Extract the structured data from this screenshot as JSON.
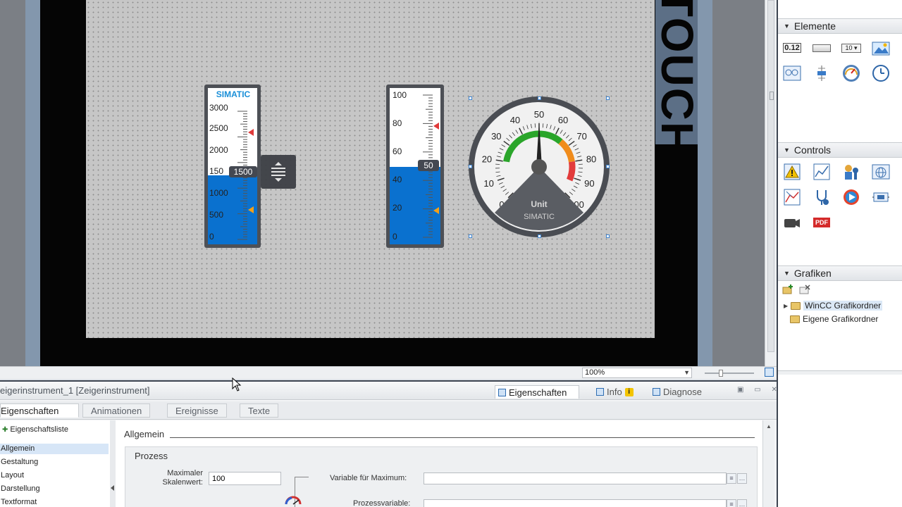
{
  "canvas": {
    "touch_label": "TOUCH",
    "bar1": {
      "title": "SIMATIC",
      "ticks": [
        "3000",
        "2500",
        "2000",
        "150",
        "1000",
        "500",
        "0"
      ],
      "readout": "1500",
      "value_fraction": 0.5,
      "upper_limit_color": "#e03a3a",
      "lower_limit_color": "#f2a01a",
      "fill_color": "#0a71cf"
    },
    "bar2": {
      "ticks": [
        "100",
        "80",
        "60",
        "40",
        "20",
        "0"
      ],
      "readout": "50",
      "value_fraction": 0.5
    },
    "gauge": {
      "ticks": [
        "0",
        "10",
        "20",
        "30",
        "40",
        "50",
        "60",
        "70",
        "80",
        "90",
        "100"
      ],
      "unit": "Unit",
      "brand": "SIMATIC",
      "value": 50,
      "zones": {
        "green": "#2aa52a",
        "orange": "#f08c1c",
        "red": "#e23b3b"
      }
    }
  },
  "zoom": {
    "value": "100%"
  },
  "properties": {
    "title": "eigerinstrument_1 [Zeigerinstrument]",
    "tabs": {
      "eigenschaften": "Eigenschaften",
      "info": "Info",
      "diagnose": "Diagnose"
    },
    "subtabs": [
      "Eigenschaften",
      "Animationen",
      "Ereignisse",
      "Texte"
    ],
    "nav": {
      "list_head": "Eigenschaftsliste",
      "items": [
        "Allgemein",
        "Gestaltung",
        "Layout",
        "Darstellung",
        "Textformat"
      ]
    },
    "section_title": "Allgemein",
    "group_title": "Prozess",
    "max_label": "Maximaler Skalenwert:",
    "max_value": "100",
    "var_max_label": "Variable für Maximum:",
    "pv_label": "Prozessvariable:"
  },
  "taskcard": {
    "elements_title": "Elemente",
    "elements_io_label": "0.12",
    "controls_title": "Controls",
    "controls_pdf": "PDF",
    "graphics_title": "Grafiken",
    "folders": [
      "WinCC Grafikordner",
      "Eigene Grafikordner"
    ]
  }
}
